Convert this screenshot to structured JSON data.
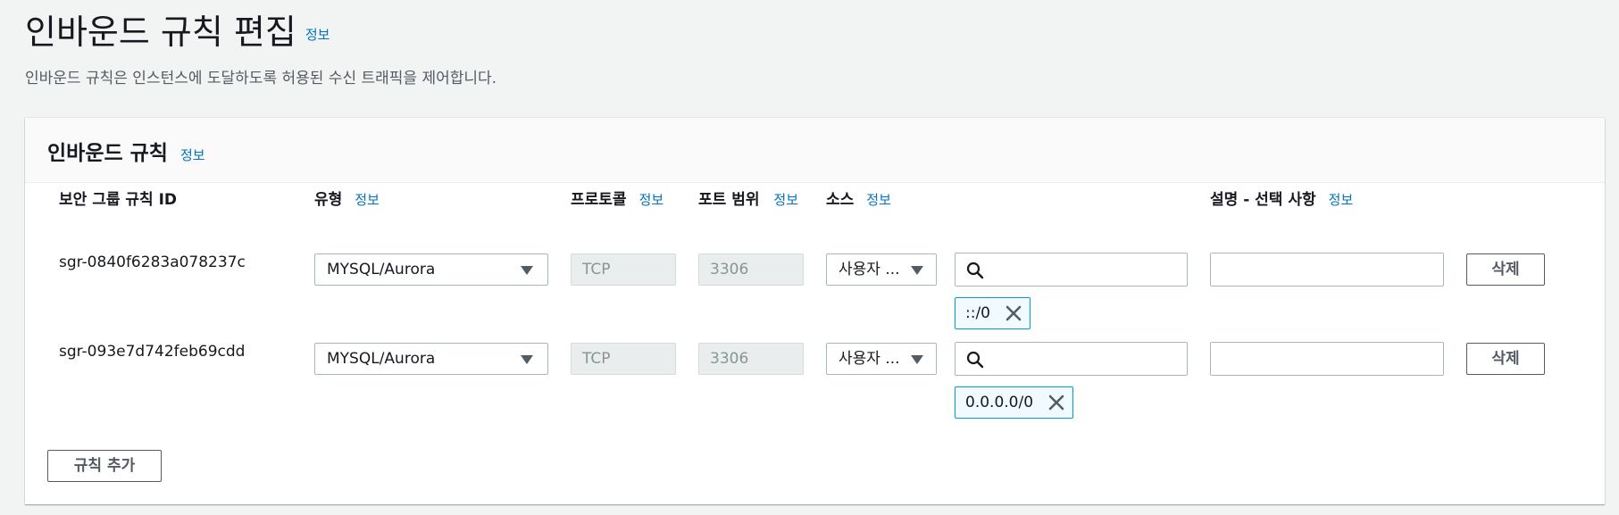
{
  "page": {
    "title": "인바운드 규칙 편집",
    "title_info": "정보",
    "description": "인바운드 규칙은 인스턴스에 도달하도록 허용된 수신 트래픽을 제어합니다."
  },
  "panel": {
    "title": "인바운드 규칙",
    "title_info": "정보",
    "columns": {
      "rule_id": "보안 그룹 규칙 ID",
      "type": "유형",
      "protocol": "프로토콜",
      "port_range": "포트 범위",
      "source": "소스",
      "description": "설명 - 선택 사항",
      "info": "정보"
    },
    "rules": [
      {
        "id": "sgr-0840f6283a078237c",
        "type": "MYSQL/Aurora",
        "protocol": "TCP",
        "port": "3306",
        "source": "사용자 ...",
        "cidr": "::/0",
        "delete_label": "삭제"
      },
      {
        "id": "sgr-093e7d742feb69cdd",
        "type": "MYSQL/Aurora",
        "protocol": "TCP",
        "port": "3306",
        "source": "사용자 ...",
        "cidr": "0.0.0.0/0",
        "delete_label": "삭제"
      }
    ],
    "add_rule_label": "규칙 추가"
  },
  "colors": {
    "background": "#f2f3f3",
    "link": "#0073bb",
    "token_border": "#00a1c9"
  }
}
